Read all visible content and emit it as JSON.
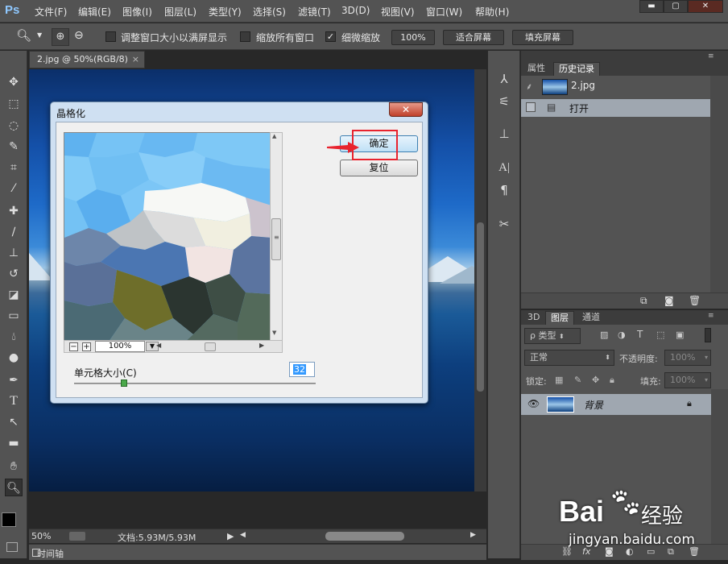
{
  "app": {
    "logo": "Ps",
    "menu": [
      "文件(F)",
      "编辑(E)",
      "图像(I)",
      "图层(L)",
      "类型(Y)",
      "选择(S)",
      "滤镜(T)",
      "3D(D)",
      "视图(V)",
      "窗口(W)",
      "帮助(H)"
    ],
    "window_buttons": [
      "▬",
      "▢",
      "✕"
    ]
  },
  "options": {
    "resize_windows": "调整窗口大小以满屏显示",
    "zoom_all": "缩放所有窗口",
    "scrubby_zoom": "细微缩放",
    "zoom_percent": "100%",
    "fit_screen": "适合屏幕",
    "fill_screen": "填充屏幕"
  },
  "document": {
    "tab_title": "2.jpg @ 50%(RGB/8)",
    "tab_close": "×",
    "zoom": "50%",
    "file_info": "文档:5.93M/5.93M"
  },
  "timeline": {
    "label": "时间轴"
  },
  "history_panel": {
    "tabs": [
      "属性",
      "历史记录"
    ],
    "snapshot_name": "2.jpg",
    "steps": [
      "打开"
    ]
  },
  "layers_panel": {
    "tabs": [
      "3D",
      "图层",
      "通道"
    ],
    "filter_kind": "类型",
    "blend_mode": "正常",
    "opacity_label": "不透明度:",
    "opacity_value": "100%",
    "lock_label": "锁定:",
    "fill_label": "填充:",
    "fill_value": "100%",
    "layer_name": "背景"
  },
  "dialog": {
    "title": "晶格化",
    "close": "✕",
    "ok": "确定",
    "reset": "复位",
    "preview_zoom": "100%",
    "cell_size_label": "单元格大小(C)",
    "cell_size_value": "32"
  },
  "watermark": {
    "brand": "Bai",
    "brand_suffix": "经验",
    "url": "jingyan.baidu.com"
  }
}
